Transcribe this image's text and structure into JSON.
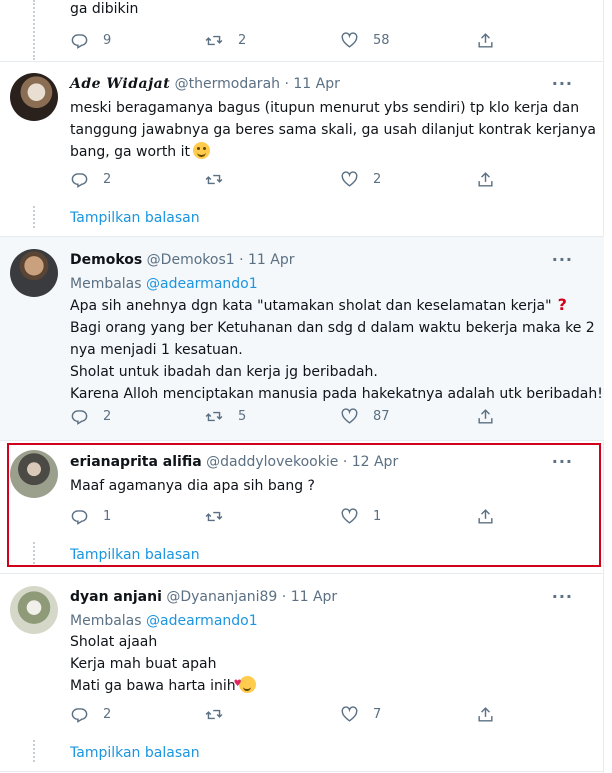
{
  "top_fragment": {
    "text": "ga dibikin",
    "actions": {
      "reply": "9",
      "retweet": "2",
      "like": "58"
    }
  },
  "tweets": [
    {
      "name": "Ade Widajat",
      "handle": "@thermodarah",
      "date": "11 Apr",
      "lines": [
        "meski beragamanya bagus (itupun menurut ybs sendiri) tp klo kerja dan",
        "tanggung jawabnya ga beres sama skali, ga usah dilanjut kontrak kerjanya",
        "bang, ga worth it"
      ],
      "emoji": "smiling-face-emoji",
      "actions": {
        "reply": "2",
        "retweet": "",
        "like": "2"
      },
      "show_replies": "Tampilkan balasan"
    },
    {
      "name": "Demokos",
      "handle": "@Demokos1",
      "date": "11 Apr",
      "reply_label": "Membalas",
      "reply_mention": "@adearmando1",
      "lines": [
        "Apa sih anehnya dgn kata \"utamakan sholat dan keselamatan kerja\"",
        "Bagi orang yang ber Ketuhanan dan sdg d dalam waktu bekerja maka ke 2",
        "nya menjadi 1 kesatuan.",
        "Sholat untuk ibadah dan kerja jg beribadah.",
        "Karena Alloh menciptakan manusia pada hakekatnya adalah utk beribadah!"
      ],
      "actions": {
        "reply": "2",
        "retweet": "5",
        "like": "87"
      }
    },
    {
      "name": "erianaprita alifia",
      "handle": "@daddylovekookie",
      "date": "12 Apr",
      "lines": [
        "Maaf agamanya dia apa sih bang ?"
      ],
      "actions": {
        "reply": "1",
        "retweet": "",
        "like": "1"
      },
      "show_replies": "Tampilkan balasan"
    },
    {
      "name": "dyan anjani",
      "handle": "@Dyananjani89",
      "date": "11 Apr",
      "reply_label": "Membalas",
      "reply_mention": "@adearmando1",
      "lines": [
        "Sholat ajaah",
        "Kerja mah buat apah",
        "Mati ga bawa harta inih"
      ],
      "emoji": "smiling-face-with-hearts-emoji",
      "actions": {
        "reply": "2",
        "retweet": "",
        "like": "7"
      },
      "show_replies": "Tampilkan balasan"
    }
  ],
  "colors": {
    "accent": "#1b95e0",
    "secondary_text": "#5b7083",
    "highlight_border": "#d0021b",
    "card_background": "#f5f8fa"
  }
}
